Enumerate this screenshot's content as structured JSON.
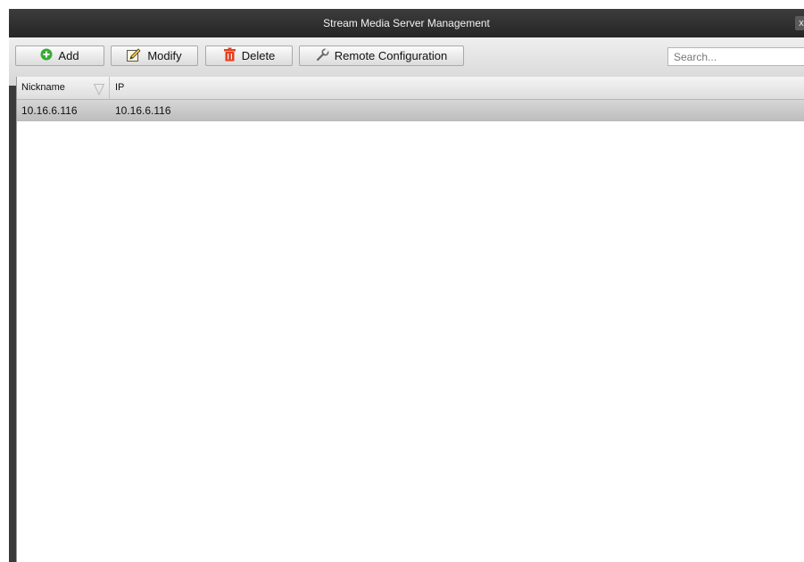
{
  "window": {
    "title": "Stream Media Server Management",
    "close_glyph": "x"
  },
  "toolbar": {
    "add_label": "Add",
    "modify_label": "Modify",
    "delete_label": "Delete",
    "remote_config_label": "Remote Configuration",
    "search_placeholder": "Search..."
  },
  "icons": {
    "add": "plus-circle-icon",
    "modify": "pencil-icon",
    "delete": "trash-icon",
    "remote_config": "wrench-icon",
    "filter": "filter-icon"
  },
  "colors": {
    "add_icon": "#3aaa35",
    "delete_icon": "#e2401f",
    "titlebar": "#2e2e2e",
    "selected_row": "#c8c8c8"
  },
  "table": {
    "columns": [
      "Nickname",
      "IP"
    ],
    "rows": [
      {
        "nickname": "10.16.6.116",
        "ip": "10.16.6.116"
      }
    ]
  }
}
